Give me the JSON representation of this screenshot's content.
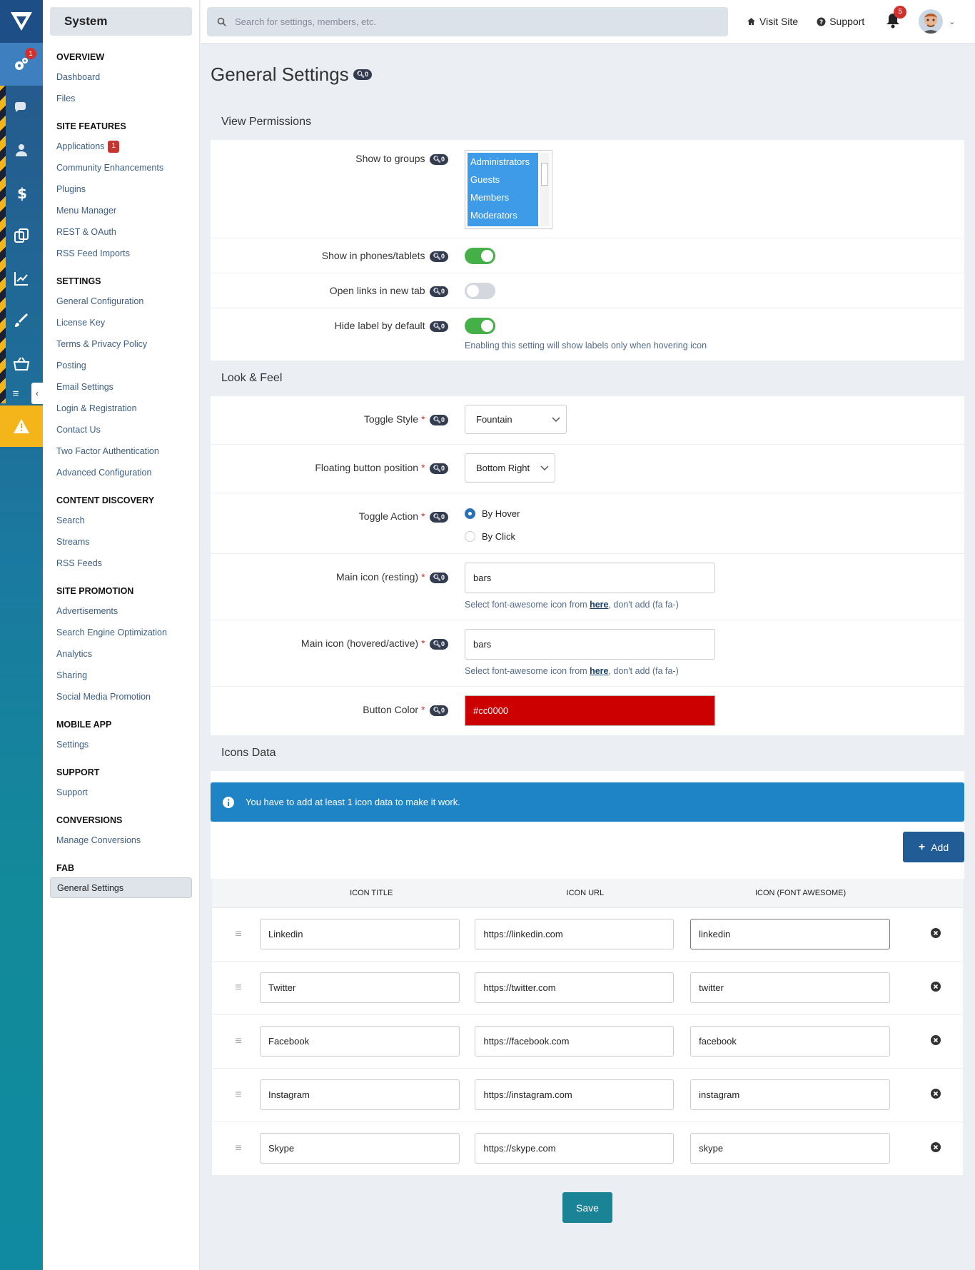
{
  "rail": {
    "settings_badge": "1"
  },
  "sidebar": {
    "title": "System",
    "groups": [
      {
        "title": "Overview",
        "items": [
          {
            "label": "Dashboard"
          },
          {
            "label": "Files"
          }
        ]
      },
      {
        "title": "Site Features",
        "items": [
          {
            "label": "Applications",
            "badge": "1"
          },
          {
            "label": "Community Enhancements"
          },
          {
            "label": "Plugins"
          },
          {
            "label": "Menu Manager"
          },
          {
            "label": "REST & OAuth"
          },
          {
            "label": "RSS Feed Imports"
          }
        ]
      },
      {
        "title": "Settings",
        "items": [
          {
            "label": "General Configuration"
          },
          {
            "label": "License Key"
          },
          {
            "label": "Terms & Privacy Policy"
          },
          {
            "label": "Posting"
          },
          {
            "label": "Email Settings"
          },
          {
            "label": "Login & Registration"
          },
          {
            "label": "Contact Us"
          },
          {
            "label": "Two Factor Authentication"
          },
          {
            "label": "Advanced Configuration"
          }
        ]
      },
      {
        "title": "Content Discovery",
        "items": [
          {
            "label": "Search"
          },
          {
            "label": "Streams"
          },
          {
            "label": "RSS Feeds"
          }
        ]
      },
      {
        "title": "Site Promotion",
        "items": [
          {
            "label": "Advertisements"
          },
          {
            "label": "Search Engine Optimization"
          },
          {
            "label": "Analytics"
          },
          {
            "label": "Sharing"
          },
          {
            "label": "Social Media Promotion"
          }
        ]
      },
      {
        "title": "Mobile App",
        "items": [
          {
            "label": "Settings"
          }
        ]
      },
      {
        "title": "Support",
        "items": [
          {
            "label": "Support"
          }
        ]
      },
      {
        "title": "Conversions",
        "items": [
          {
            "label": "Manage Conversions"
          }
        ]
      },
      {
        "title": "FAB",
        "items": [
          {
            "label": "General Settings",
            "selected": true
          }
        ]
      }
    ]
  },
  "topbar": {
    "search_placeholder": "Search for settings, members, etc.",
    "visit_site": "Visit Site",
    "support": "Support",
    "notif_count": "5"
  },
  "page": {
    "title": "General Settings",
    "title_badge": "0"
  },
  "view_permissions": {
    "section": "View Permissions",
    "show_to_groups": {
      "label": "Show to groups",
      "badge": "0",
      "options": [
        "Administrators",
        "Guests",
        "Members",
        "Moderators"
      ]
    },
    "phones": {
      "label": "Show in phones/tablets",
      "badge": "0",
      "on": true
    },
    "newtab": {
      "label": "Open links in new tab",
      "badge": "0",
      "on": false
    },
    "hidelabel": {
      "label": "Hide label by default",
      "badge": "0",
      "on": true,
      "hint": "Enabling this setting will show labels only when hovering icon"
    }
  },
  "look_feel": {
    "section": "Look & Feel",
    "toggle_style": {
      "label": "Toggle Style",
      "badge": "0",
      "value": "Fountain"
    },
    "position": {
      "label": "Floating button position",
      "badge": "0",
      "value": "Bottom Right"
    },
    "toggle_action": {
      "label": "Toggle Action",
      "badge": "0",
      "options": [
        "By Hover",
        "By Click"
      ],
      "selected": "By Hover"
    },
    "main_icon": {
      "label": "Main icon (resting)",
      "badge": "0",
      "value": "bars"
    },
    "main_icon_hover": {
      "label": "Main icon (hovered/active)",
      "badge": "0",
      "value": "bars"
    },
    "hint_pre": "Select font-awesome icon from ",
    "hint_link": "here",
    "hint_post": ", don't add (fa fa-)",
    "button_color": {
      "label": "Button Color",
      "badge": "0",
      "value": "#cc0000"
    }
  },
  "icons_data": {
    "section": "Icons Data",
    "alert": "You have to add at least 1 icon data to make it work.",
    "add": "Add",
    "columns": [
      "Icon Title",
      "Icon URL",
      "Icon (Font Awesome)"
    ],
    "rows": [
      {
        "title": "Linkedin",
        "url": "https://linkedin.com",
        "icon": "linkedin"
      },
      {
        "title": "Twitter",
        "url": "https://twitter.com",
        "icon": "twitter"
      },
      {
        "title": "Facebook",
        "url": "https://facebook.com",
        "icon": "facebook"
      },
      {
        "title": "Instagram",
        "url": "https://instagram.com",
        "icon": "instagram"
      },
      {
        "title": "Skype",
        "url": "https://skype.com",
        "icon": "skype"
      }
    ]
  },
  "save": "Save",
  "colors": {
    "accent": "#225c97",
    "toggle_on": "#45b047",
    "button_color": "#cc0000",
    "alert": "#1f84c6",
    "save": "#1b8396"
  }
}
